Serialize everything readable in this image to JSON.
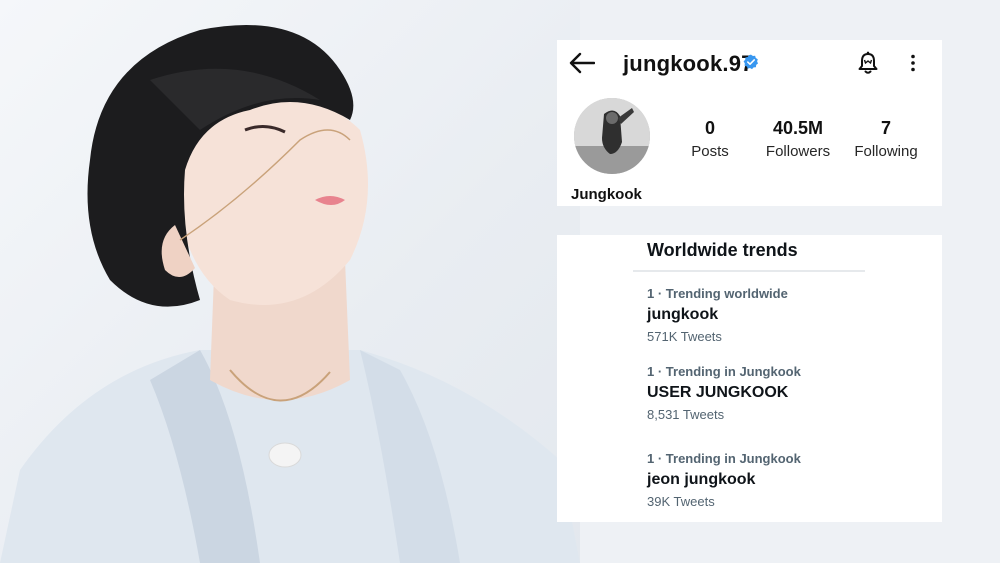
{
  "profile": {
    "handle": "jungkook.97",
    "display_name": "Jungkook",
    "stats": [
      {
        "value": "0",
        "label": "Posts"
      },
      {
        "value": "40.5M",
        "label": "Followers"
      },
      {
        "value": "7",
        "label": "Following"
      }
    ]
  },
  "trends": {
    "title": "Worldwide trends",
    "items": [
      {
        "context": "1 · Trending worldwide",
        "name": "jungkook",
        "count": "571K Tweets"
      },
      {
        "context": "1 · Trending in Jungkook",
        "name": "USER JUNGKOOK",
        "count": "8,531 Tweets"
      },
      {
        "context": "1 · Trending in Jungkook",
        "name": "jeon jungkook",
        "count": "39K Tweets"
      }
    ]
  },
  "icons": {
    "back": "arrow-left-icon",
    "verified": "verified-badge-icon",
    "notifications": "bell-icon",
    "more": "more-vertical-icon"
  },
  "colors": {
    "verified_blue": "#3897f0",
    "text_primary": "#0f1419",
    "text_secondary": "#536471",
    "card_bg": "#ffffff"
  }
}
